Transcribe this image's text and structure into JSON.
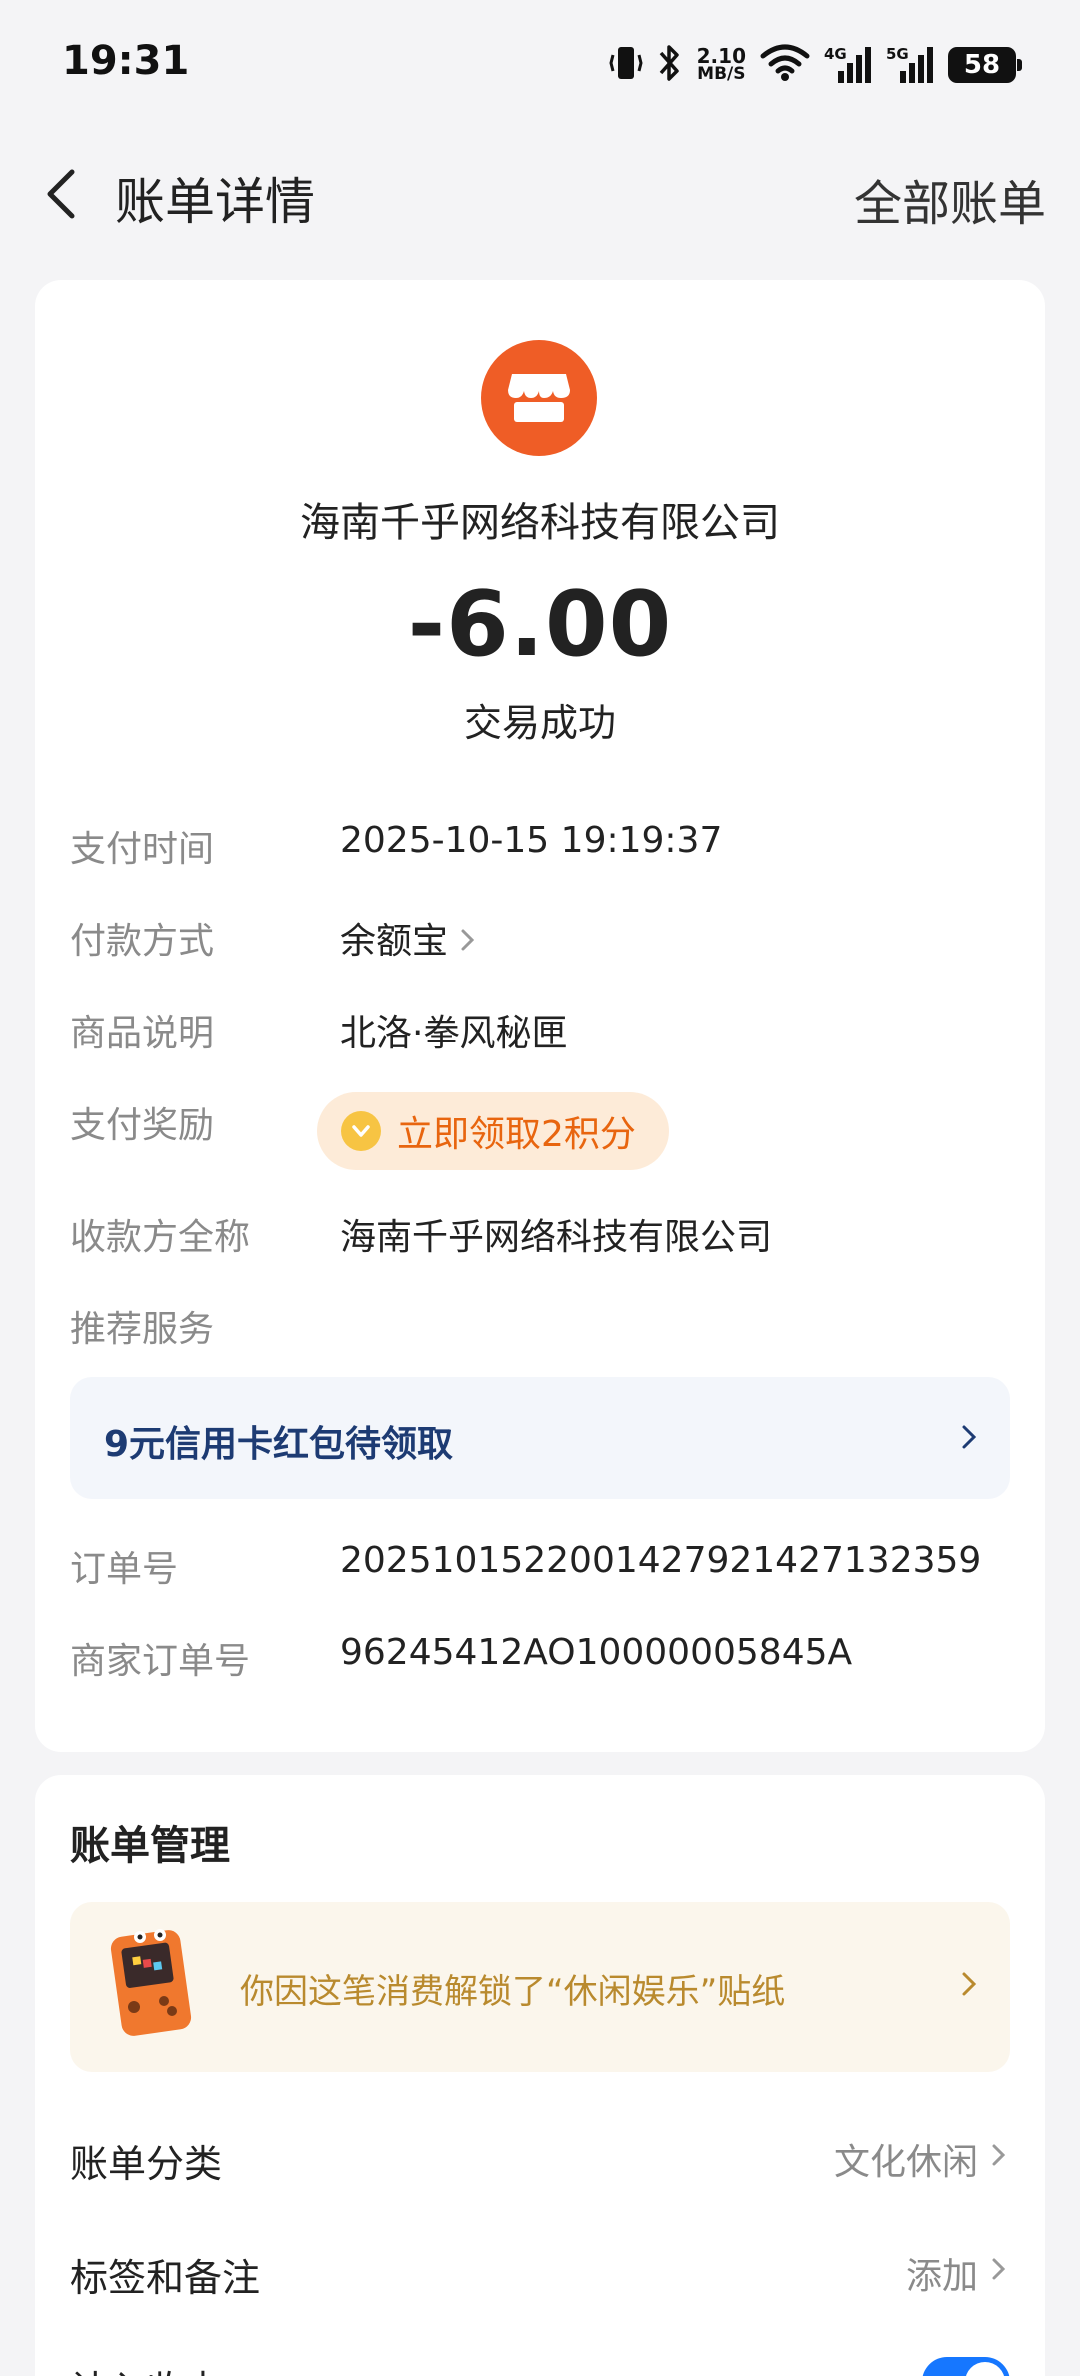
{
  "status_bar": {
    "time": "19:31",
    "net_speed_value": "2.10",
    "net_speed_unit": "MB/S",
    "network_4g": "4G",
    "network_5g": "5G",
    "battery": "58"
  },
  "header": {
    "title": "账单详情",
    "right_link": "全部账单"
  },
  "transaction": {
    "merchant": "海南千乎网络科技有限公司",
    "amount": "-6.00",
    "status": "交易成功"
  },
  "details": {
    "pay_time_label": "支付时间",
    "pay_time_value": "2025-10-15 19:19:37",
    "pay_method_label": "付款方式",
    "pay_method_value": "余额宝",
    "goods_label": "商品说明",
    "goods_value": "北洛·拳风秘匣",
    "reward_label": "支付奖励",
    "reward_value": "立即领取2积分",
    "payee_label": "收款方全称",
    "payee_value": "海南千乎网络科技有限公司",
    "recommend_label": "推荐服务",
    "promo_text": "9元信用卡红包待领取",
    "order_no_label": "订单号",
    "order_no_value": "2025101522001427921427132359",
    "merchant_order_label": "商家订单号",
    "merchant_order_value": "96245412AO10000005845A"
  },
  "manage": {
    "title": "账单管理",
    "sticker_text": "你因这笔消费解锁了“休闲娱乐”贴纸",
    "category_label": "账单分类",
    "category_value": "文化休闲",
    "tags_label": "标签和备注",
    "tags_value": "添加",
    "partial_label": "计入收支"
  },
  "colors": {
    "accent_orange": "#ef5d26",
    "reward_text": "#e8650f",
    "promo_text": "#1d3b73",
    "toggle_blue": "#1677ff"
  }
}
